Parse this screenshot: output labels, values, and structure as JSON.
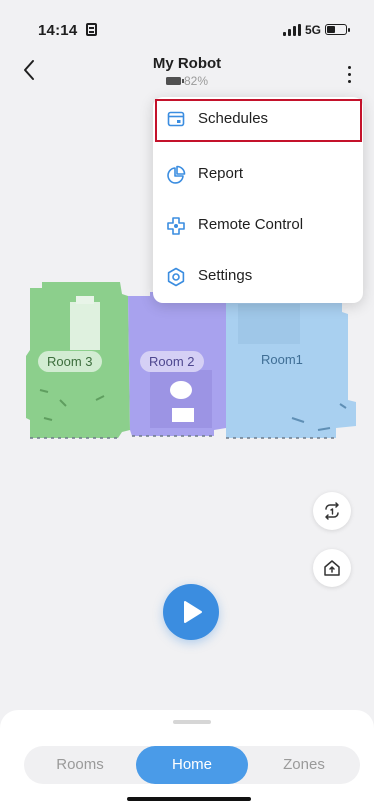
{
  "status_bar": {
    "time": "14:14",
    "network": "5G"
  },
  "header": {
    "title": "My Robot",
    "battery_percent": "82%"
  },
  "menu": {
    "items": [
      {
        "label": "Schedules",
        "icon": "calendar-icon",
        "highlighted": true
      },
      {
        "label": "Report",
        "icon": "pie-chart-icon",
        "highlighted": false
      },
      {
        "label": "Remote Control",
        "icon": "dpad-icon",
        "highlighted": false
      },
      {
        "label": "Settings",
        "icon": "gear-icon",
        "highlighted": false
      }
    ]
  },
  "map": {
    "rooms": [
      {
        "label": "Room 3",
        "color": "#8ccf8c"
      },
      {
        "label": "Room 2",
        "color": "#a8a2ee"
      },
      {
        "label": "Room1",
        "color": "#a9d0f0"
      }
    ]
  },
  "controls": {
    "side_buttons": [
      "repeat-once-icon",
      "home-dock-icon"
    ],
    "start_icon": "play-icon"
  },
  "tabs": {
    "items": [
      "Rooms",
      "Home",
      "Zones"
    ],
    "active": "Home"
  },
  "colors": {
    "accent": "#3b8de0",
    "highlight_border": "#c4122b",
    "background": "#f1f1f3"
  }
}
